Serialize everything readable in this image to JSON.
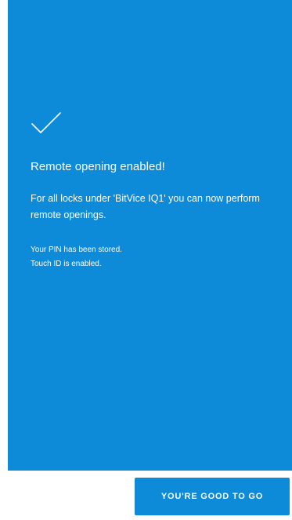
{
  "confirmation": {
    "icon": "checkmark-icon",
    "title": "Remote opening enabled!",
    "description": "For all locks under 'BitVice IQ1' you can now perform remote openings.",
    "status_lines": [
      "Your PIN has been stored.",
      "Touch ID is enabled."
    ]
  },
  "footer": {
    "button_label": "YOU'RE GOOD TO GO"
  },
  "colors": {
    "accent": "#0d8ad8",
    "background": "#ffffff",
    "text_on_accent": "#ffffff"
  }
}
